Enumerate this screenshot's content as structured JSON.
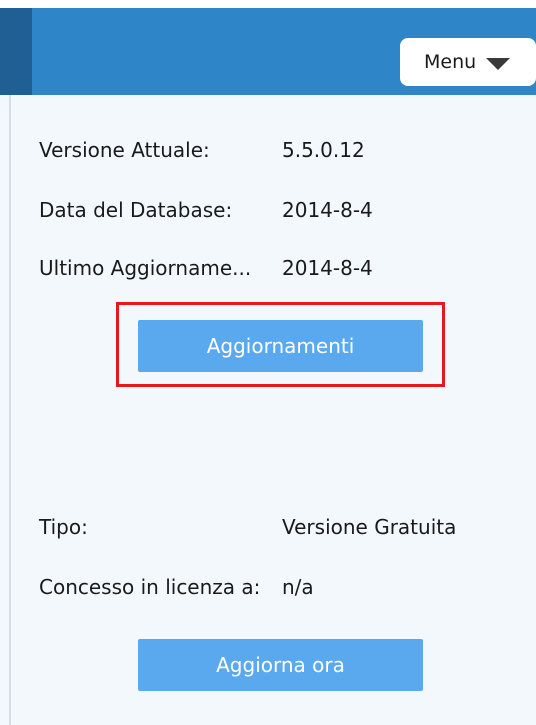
{
  "header": {
    "menu_label": "Menu",
    "menu_icon": "chevron-down-icon",
    "background_color": "#2e86c8"
  },
  "version_info": {
    "current_version_label": "Versione Attuale:",
    "current_version_value": "5.5.0.12",
    "database_date_label": "Data del Database:",
    "database_date_value": "2014-8-4",
    "last_update_label": "Ultimo Aggiorname...",
    "last_update_value": "2014-8-4",
    "update_button_label": "Aggiornamenti"
  },
  "license_info": {
    "type_label": "Tipo:",
    "type_value": "Versione Gratuita",
    "licensed_to_label": "Concesso in licenza a:",
    "licensed_to_value": "n/a",
    "upgrade_button_label": "Aggiorna ora"
  },
  "colors": {
    "button": "#5aa9ef",
    "highlight": "#e8161f",
    "panel_background": "#f3f8fc"
  }
}
